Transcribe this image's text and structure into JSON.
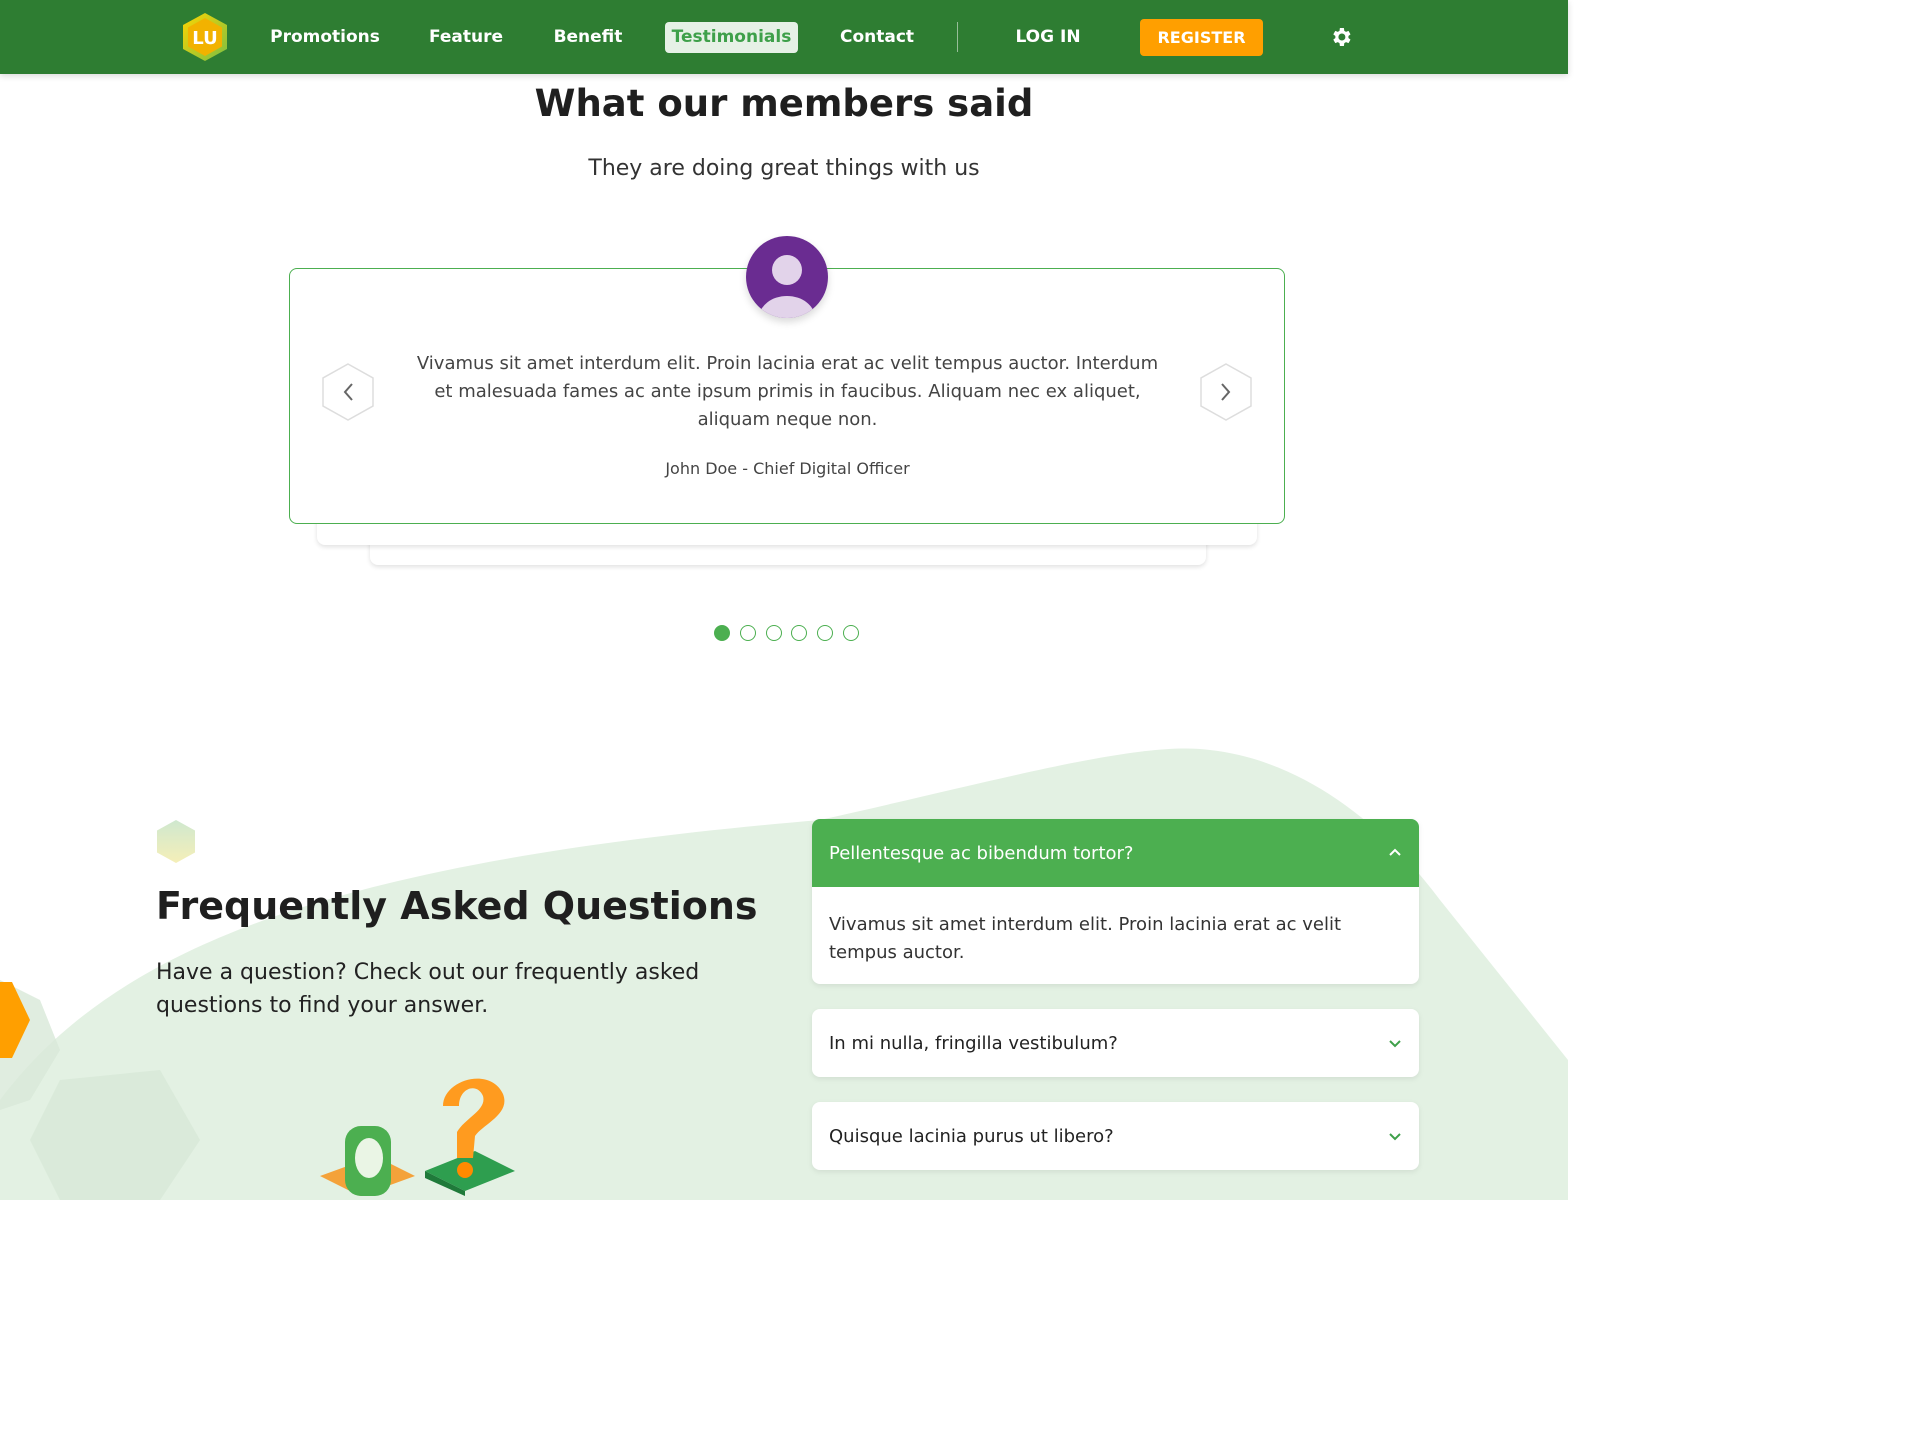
{
  "header": {
    "logo_text": "LU",
    "nav": [
      {
        "label": "Promotions"
      },
      {
        "label": "Feature"
      },
      {
        "label": "Benefit"
      },
      {
        "label": "Testimonials",
        "active": true
      },
      {
        "label": "Contact"
      }
    ],
    "login_label": "LOG IN",
    "register_label": "REGISTER",
    "settings_icon": "gear-icon"
  },
  "testimonials": {
    "title": "What our members said",
    "subtitle": "They are doing great things with us",
    "quote": "Vivamus sit amet interdum elit. Proin lacinia erat ac velit tempus auctor. Interdum et malesuada fames ac ante ipsum primis in faucibus. Aliquam nec ex aliquet, aliquam neque non.",
    "author": "John Doe - Chief Digital Officer",
    "prev_icon": "chevron-left-icon",
    "next_icon": "chevron-right-icon",
    "slide_count": 6,
    "active_slide": 1
  },
  "faq": {
    "title": "Frequently Asked Questions",
    "description": "Have a question? Check out our frequently asked questions to find your answer.",
    "items": [
      {
        "question": "Pellentesque ac bibendum tortor?",
        "answer": "Vivamus sit amet interdum elit. Proin lacinia erat ac velit tempus auctor.",
        "open": true
      },
      {
        "question": "In mi nulla, fringilla vestibulum?",
        "open": false
      },
      {
        "question": "Quisque lacinia purus ut libero?",
        "open": false
      }
    ]
  },
  "colors": {
    "header_bg": "#2e7d32",
    "accent_green": "#4caf50",
    "register_orange": "#ff9f00",
    "avatar_purple": "#6a2c91",
    "faq_bg": "#e3f1e3"
  }
}
